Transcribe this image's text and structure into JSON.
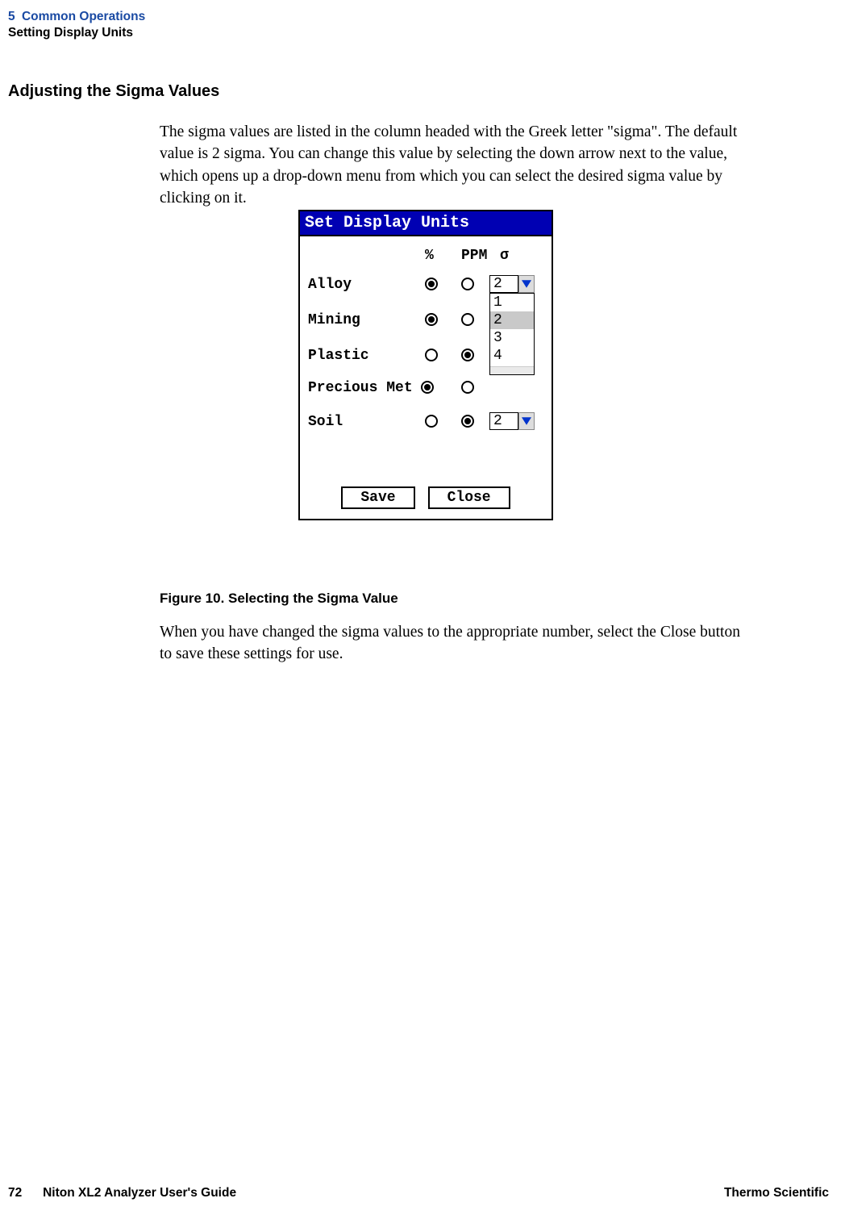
{
  "header": {
    "chapter_num": "5",
    "chapter_title": "Common Operations",
    "section": "Setting Display Units"
  },
  "heading": "Adjusting the Sigma Values",
  "body1": "The sigma values are listed in the column headed with the Greek letter \"sigma\". The default value is 2 sigma. You can change this value by selecting the down arrow next to the value, which opens up a drop-down menu from which you can select the desired sigma value by clicking on it.",
  "figure": {
    "title": "Set Display Units",
    "col_pc": "%",
    "col_ppm": "PPM",
    "col_sigma": "σ",
    "rows": [
      {
        "label": "Alloy",
        "pc_selected": true,
        "ppm_selected": false,
        "sigma": "2"
      },
      {
        "label": "Mining",
        "pc_selected": true,
        "ppm_selected": false,
        "sigma": ""
      },
      {
        "label": "Plastic",
        "pc_selected": false,
        "ppm_selected": true,
        "sigma": ""
      },
      {
        "label": "Precious Met",
        "pc_selected": true,
        "ppm_selected": false,
        "sigma": ""
      },
      {
        "label": "Soil",
        "pc_selected": false,
        "ppm_selected": true,
        "sigma": "2"
      }
    ],
    "dropdown_options": [
      "1",
      "2",
      "3",
      "4"
    ],
    "dropdown_highlighted": "2",
    "save_label": "Save",
    "close_label": "Close"
  },
  "figure_caption": "Figure 10.   Selecting the Sigma Value",
  "body2": "When you have changed the sigma values to the appropriate number, select the Close button to save these settings for use.",
  "footer": {
    "page_num": "72",
    "guide": "Niton XL2 Analyzer User's Guide",
    "company": "Thermo Scientific"
  }
}
